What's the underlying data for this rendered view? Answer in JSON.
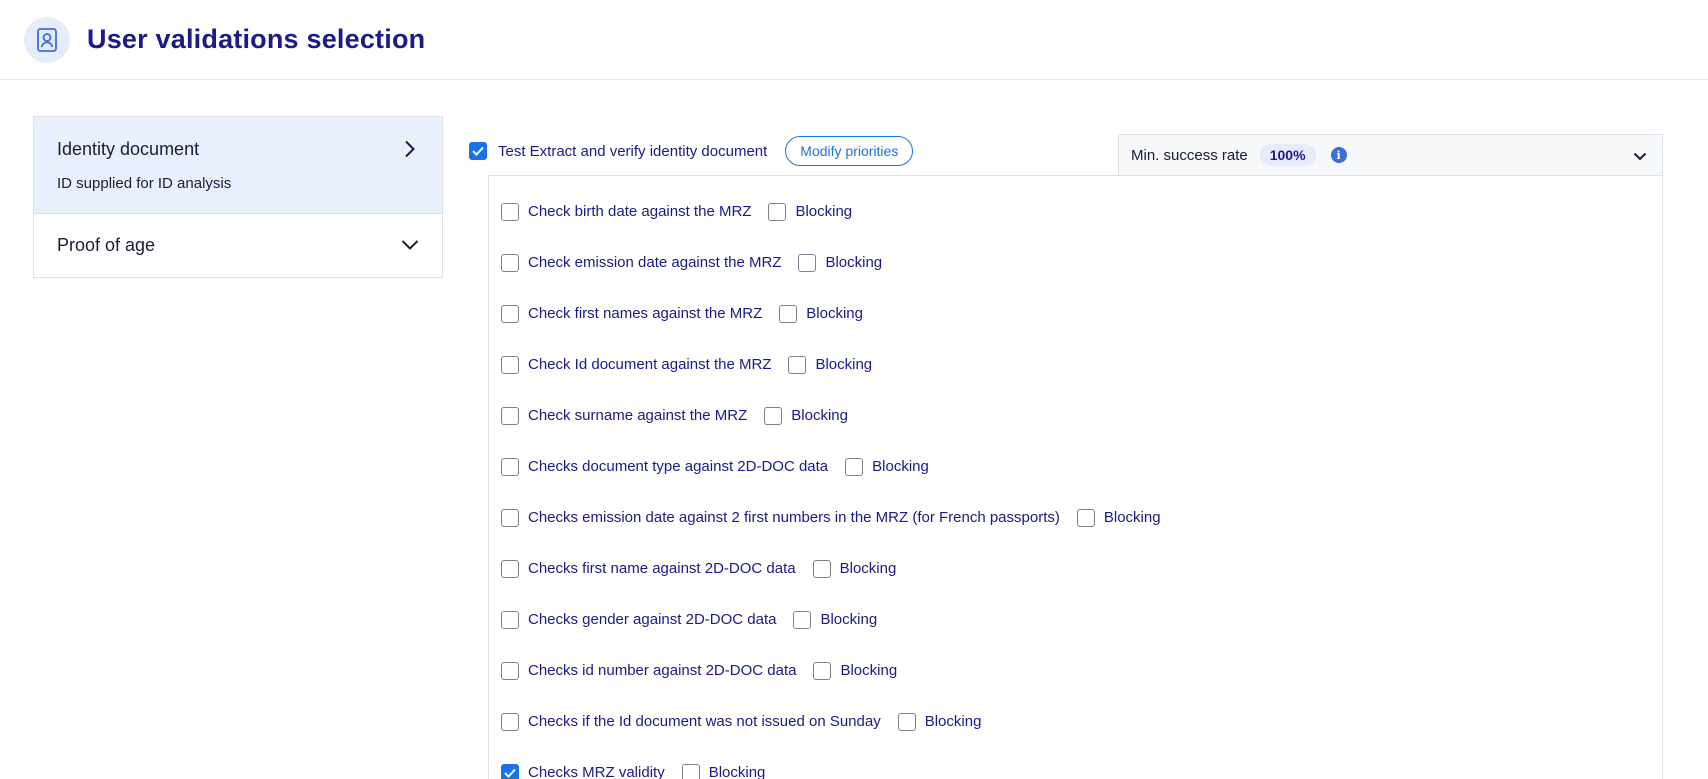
{
  "header": {
    "title": "User validations selection",
    "icon": "id-card-icon"
  },
  "sidebar": {
    "items": [
      {
        "title": "Identity document",
        "subtitle": "ID supplied for ID analysis",
        "active": true,
        "chevron": "chevron-right-icon"
      },
      {
        "title": "Proof of age",
        "subtitle": "",
        "active": false,
        "chevron": "chevron-down-icon"
      }
    ]
  },
  "main": {
    "label": "Test Extract and verify identity document",
    "checked": true,
    "modify_label": "Modify priorities"
  },
  "rate": {
    "label": "Min. success rate",
    "value": "100%",
    "info_icon": "info-icon",
    "chevron": "chevron-down-icon"
  },
  "validations": [
    {
      "label": "Check birth date against the MRZ",
      "checked": false,
      "blocking_label": "Blocking",
      "blocking": false
    },
    {
      "label": "Check emission date against the MRZ",
      "checked": false,
      "blocking_label": "Blocking",
      "blocking": false
    },
    {
      "label": "Check first names against the MRZ",
      "checked": false,
      "blocking_label": "Blocking",
      "blocking": false
    },
    {
      "label": "Check Id document against the MRZ",
      "checked": false,
      "blocking_label": "Blocking",
      "blocking": false
    },
    {
      "label": "Check surname against the MRZ",
      "checked": false,
      "blocking_label": "Blocking",
      "blocking": false
    },
    {
      "label": "Checks document type against 2D-DOC data",
      "checked": false,
      "blocking_label": "Blocking",
      "blocking": false
    },
    {
      "label": "Checks emission date against 2 first numbers in the MRZ (for French passports)",
      "checked": false,
      "blocking_label": "Blocking",
      "blocking": false
    },
    {
      "label": "Checks first name against 2D-DOC data",
      "checked": false,
      "blocking_label": "Blocking",
      "blocking": false
    },
    {
      "label": "Checks gender against 2D-DOC data",
      "checked": false,
      "blocking_label": "Blocking",
      "blocking": false
    },
    {
      "label": "Checks id number against 2D-DOC data",
      "checked": false,
      "blocking_label": "Blocking",
      "blocking": false
    },
    {
      "label": "Checks if the Id document was not issued on Sunday",
      "checked": false,
      "blocking_label": "Blocking",
      "blocking": false
    },
    {
      "label": "Checks MRZ validity",
      "checked": true,
      "blocking_label": "Blocking",
      "blocking": false
    }
  ],
  "colors": {
    "accent": "#1a73e8",
    "title": "#1a1a8c",
    "active_bg": "#e8f0fe"
  }
}
